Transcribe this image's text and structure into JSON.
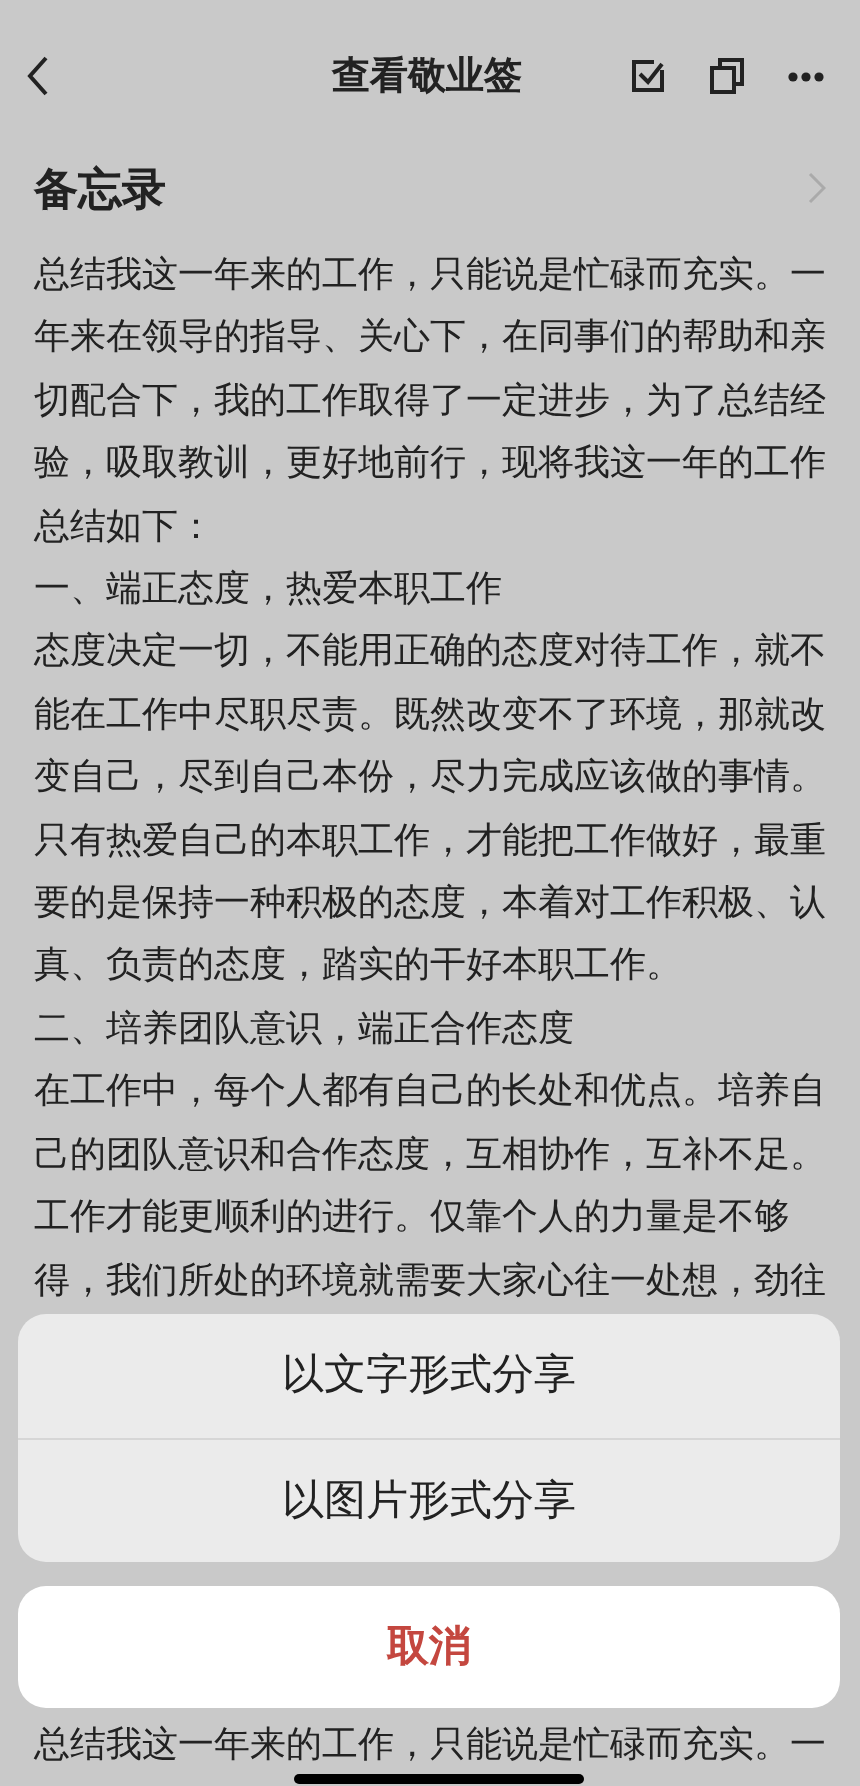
{
  "nav_bar": {
    "title": "查看敬业签"
  },
  "note": {
    "heading": "备忘录",
    "paragraphs": [
      "总结我这一年来的工作，只能说是忙碌而充实。一年来在领导的指导、关心下，在同事们的帮助和亲切配合下，我的工作取得了一定进步，为了总结经验，吸取教训，更好地前行，现将我这一年的工作总结如下：",
      "一、端正态度，热爱本职工作",
      "态度决定一切，不能用正确的态度对待工作，就不能在工作中尽职尽责。既然改变不了环境，那就改变自己，尽到自己本份，尽力完成应该做的事情。只有热爱自己的本职工作，才能把工作做好，最重要的是保持一种积极的态度，本着对工作积极、认真、负责的态度，踏实的干好本职工作。",
      "二、培养团队意识，端正合作态度",
      "在工作中，每个人都有自己的长处和优点。培养自己的团队意识和合作态度，互相协作，互补不足。工作才能更顺利的进行。仅靠个人的力量是不够得，我们所处的环境就需要大家心往一处想，劲往"
    ],
    "preview_line": "总结我这一年来的工作，只能说是忙碌而充实。一"
  },
  "share_sheet": {
    "options": [
      "以文字形式分享",
      "以图片形式分享"
    ],
    "cancel": "取消"
  }
}
